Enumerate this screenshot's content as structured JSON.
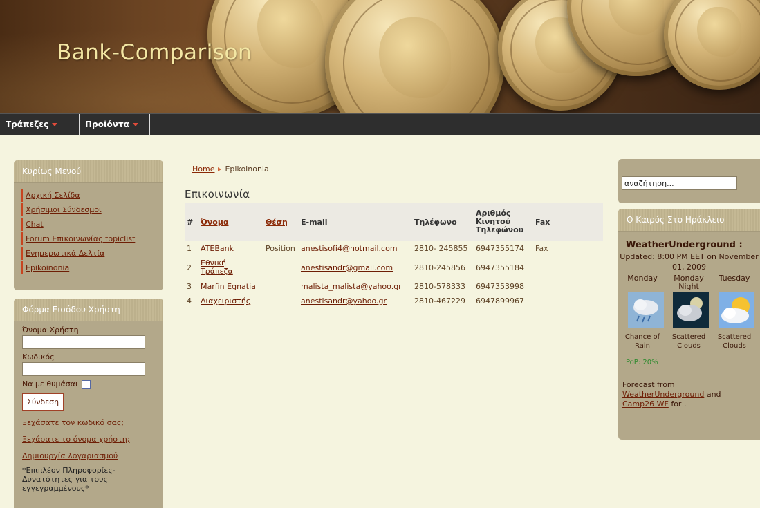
{
  "header": {
    "site_title": "Bank-Comparison"
  },
  "nav": {
    "items": [
      {
        "label": "Τράπεζες"
      },
      {
        "label": "Προϊόντα"
      }
    ]
  },
  "main_menu": {
    "title": "Κυρίως Μενού",
    "items": [
      {
        "label": "Αρχική Σελίδα"
      },
      {
        "label": "Χρήσιμοι Σύνδεσμοι"
      },
      {
        "label": "Chat"
      },
      {
        "label": "Forum Επικοινωνίας topiclist"
      },
      {
        "label": "Ενημερωτικά Δελτία"
      },
      {
        "label": "Epikoinonia"
      }
    ]
  },
  "login": {
    "title": "Φόρμα Εισόδου Χρήστη",
    "username_label": "Όνομα Χρήστη",
    "password_label": "Κωδικός",
    "remember_label": "Να με θυμάσαι",
    "submit_label": "Σύνδεση",
    "forgot_password": "Ξεχάσατε τον κωδικό σας;",
    "forgot_username": "Ξεχάσατε το όνομα χρήστη;",
    "create_account": "Δημιουργία λογαριασμού",
    "note": "*Επιπλέον Πληροφορίες-Δυνατότητες για τους εγγεγραμμένους*"
  },
  "breadcrumb": {
    "home": "Home",
    "current": "Epikoinonia"
  },
  "page_title": "Επικοινωνία",
  "contacts": {
    "headers": {
      "num": "#",
      "name": "Όνομα",
      "position": "Θέση",
      "email": "E-mail",
      "phone": "Τηλέφωνο",
      "mobile": "Αριθμός Κινητού Τηλεφώνου",
      "fax": "Fax"
    },
    "rows": [
      {
        "num": "1",
        "name": "ATEBank",
        "position": "Position",
        "email": "anestisofi4@hotmail.com",
        "phone": "2810- 245855",
        "mobile": "6947355174",
        "fax": "Fax"
      },
      {
        "num": "2",
        "name": "Εθνική Τράπεζα",
        "position": "",
        "email": "anestisandr@gmail.com",
        "phone": "2810-245856",
        "mobile": "6947355184",
        "fax": ""
      },
      {
        "num": "3",
        "name": "Marfin Egnatia",
        "position": "",
        "email": "malista_malista@yahoo.gr",
        "phone": "2810-578333",
        "mobile": "6947353998",
        "fax": ""
      },
      {
        "num": "4",
        "name": "Διαχειριστής",
        "position": "",
        "email": "anestisandr@yahoo.gr",
        "phone": "2810-467229",
        "mobile": "6947899967",
        "fax": ""
      }
    ]
  },
  "search": {
    "value": "αναζήτηση..."
  },
  "weather": {
    "title": "Ο Καιρός Στο Ηράκλειο",
    "brand": "WeatherUnderground :",
    "updated": "Updated: 8:00 PM EET on November 01, 2009",
    "days": [
      {
        "day": "Monday",
        "cond": "Chance of Rain",
        "icon": "rain-icon"
      },
      {
        "day": "Monday Night",
        "cond": "Scattered Clouds",
        "icon": "cloudy-night-icon"
      },
      {
        "day": "Tuesday",
        "cond": "Scattered Clouds",
        "icon": "partly-cloudy-icon"
      }
    ],
    "pop": "PoP: 20%",
    "forecast_prefix": "Forecast from",
    "forecast_link1": "WeatherUnderground",
    "forecast_and": "and",
    "forecast_link2": "Camp26 WF",
    "forecast_suffix": "for ."
  }
}
